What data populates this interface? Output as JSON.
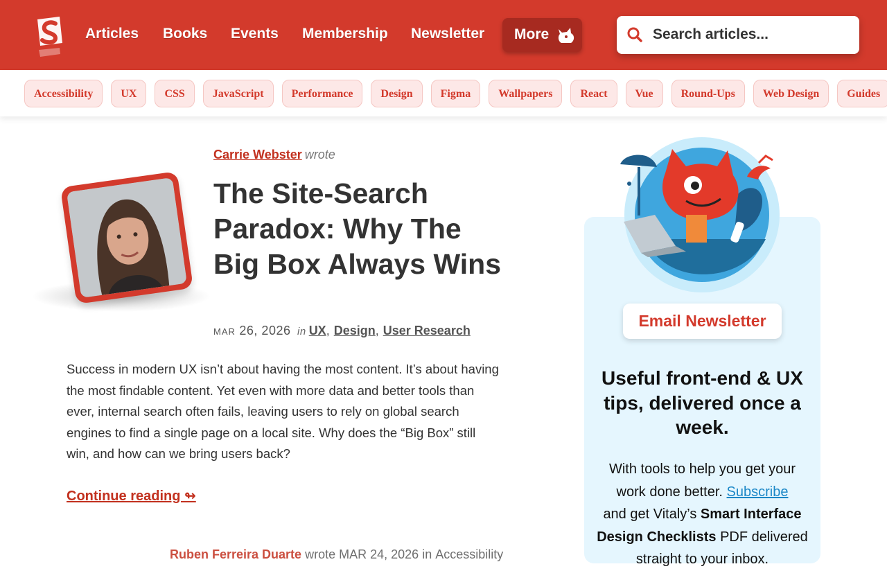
{
  "header": {
    "logo_letter": "S",
    "nav": [
      "Articles",
      "Books",
      "Events",
      "Membership",
      "Newsletter"
    ],
    "more_label": "More",
    "search_placeholder": "Search articles..."
  },
  "tags": [
    "Accessibility",
    "UX",
    "CSS",
    "JavaScript",
    "Performance",
    "Design",
    "Figma",
    "Wallpapers",
    "React",
    "Vue",
    "Round-Ups",
    "Web Design",
    "Guides"
  ],
  "article": {
    "author": "Carrie Webster",
    "wrote": "wrote",
    "title": "The Site-Search Paradox: Why The Big Box Always Wins",
    "date_month": "Mar",
    "date_rest": "26, 2026",
    "in": "in",
    "categories": [
      "UX",
      "Design",
      "User Research"
    ],
    "excerpt": "Success in modern UX isn’t about having the most content. It’s about having the most findable content. Yet even with more data and better tools than ever, internal search often fails, leaving users to rely on global search engines to find a single page on a local site. Why does the “Big Box” still win, and how can we bring users back?",
    "continue": "Continue reading ↬"
  },
  "next_article": {
    "author": "Ruben Ferreira Duarte",
    "wrote": "wrote",
    "date": "MAR 24, 2026",
    "in": "in",
    "category": "Accessibility"
  },
  "sidebar": {
    "button": "Email Newsletter",
    "headline": "Useful front-end & UX tips, delivered once a week.",
    "text_before": "With tools to help you get your work done better.",
    "subscribe": "Subscribe",
    "text_middle": "and get Vitaly’s",
    "bold_text": "Smart Interface Design Checklists",
    "text_after": "PDF delivered straight to your inbox."
  },
  "colors": {
    "brand": "#d33a2c",
    "panel": "#e5f6fe",
    "link": "#1b87c7"
  }
}
